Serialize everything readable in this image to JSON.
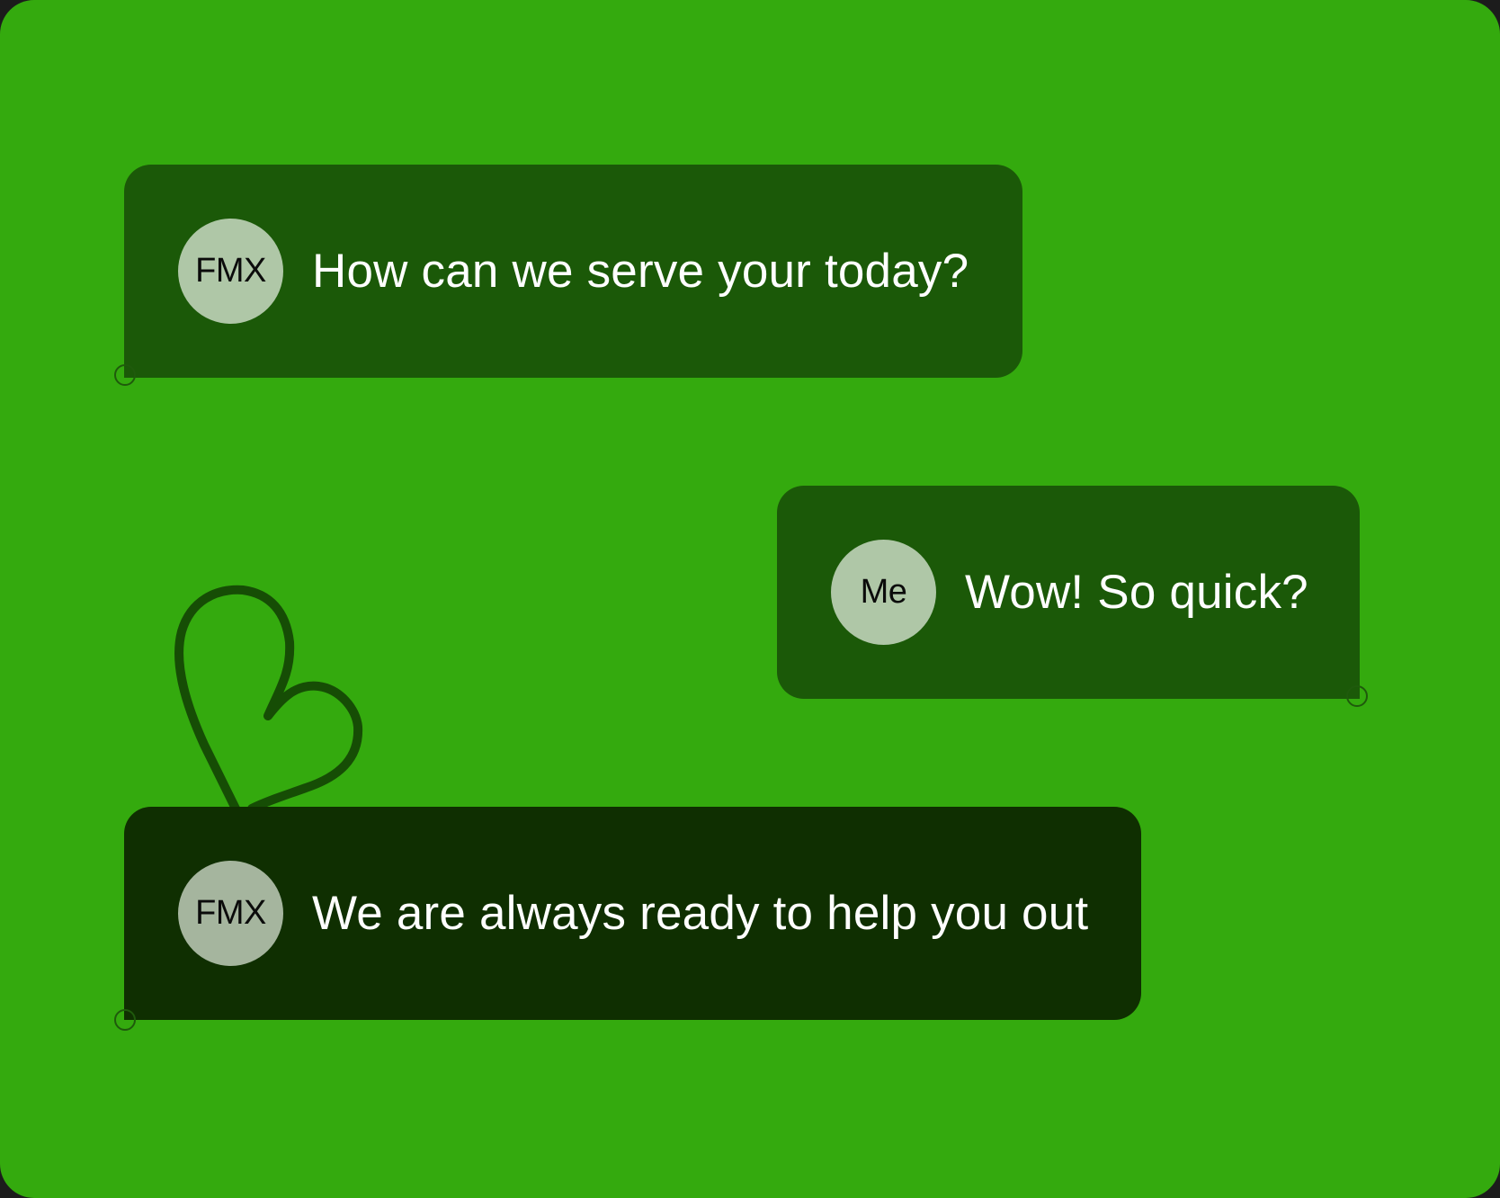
{
  "colors": {
    "background": "#34aa0e",
    "bubble": "#1b5908",
    "bubble_dark": "#0f2f01",
    "avatar": "#afc7a7",
    "text": "#ffffff"
  },
  "messages": [
    {
      "sender": "FMX",
      "text": "How can we serve your today?"
    },
    {
      "sender": "Me",
      "text": "Wow! So quick?"
    },
    {
      "sender": "FMX",
      "text": "We are always ready to help you out"
    }
  ],
  "decorations": {
    "heart_icon": "heart-outline-icon",
    "corner_marker_icon": "circle-outline-icon"
  }
}
